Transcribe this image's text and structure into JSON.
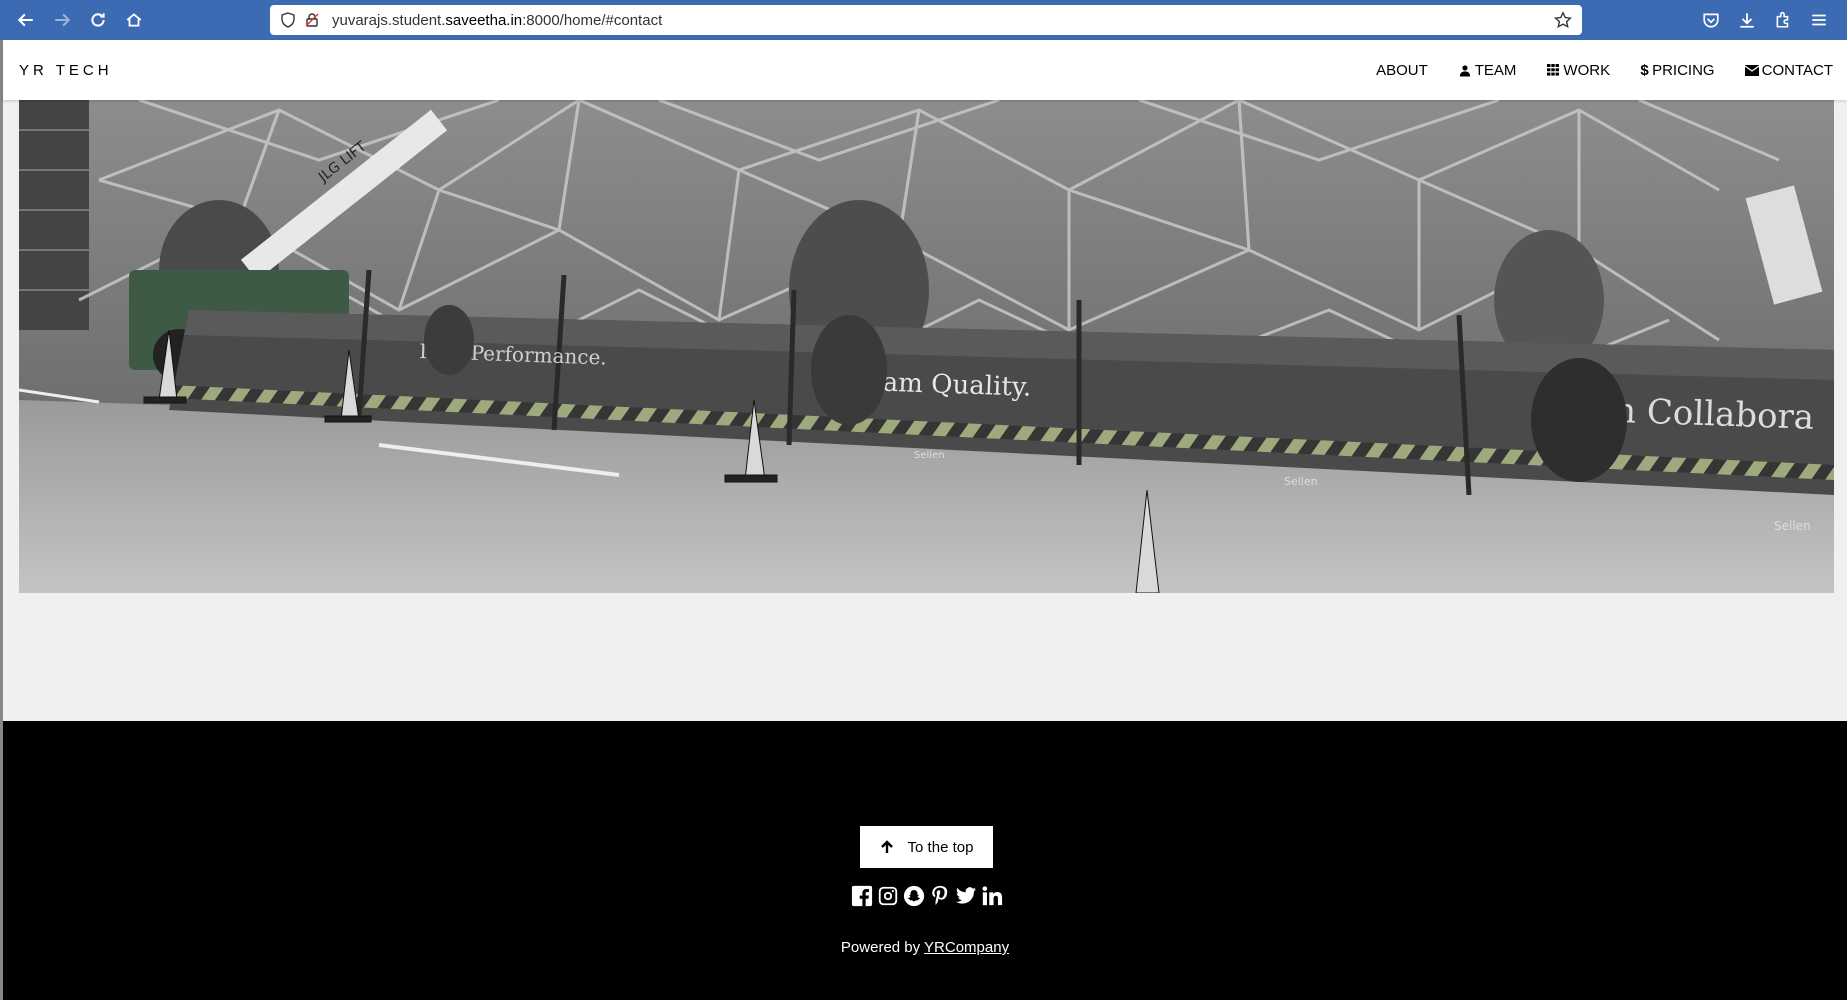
{
  "browser": {
    "url_prefix": "yuvarajs.student.",
    "url_domain": "saveetha.in",
    "url_suffix": ":8000/home/#contact"
  },
  "site": {
    "brand": "YR TECH",
    "nav": [
      {
        "label": "ABOUT",
        "icon": ""
      },
      {
        "label": "TEAM",
        "icon": "user-icon"
      },
      {
        "label": "WORK",
        "icon": "grid-icon"
      },
      {
        "label": "PRICING",
        "icon": "dollar-icon"
      },
      {
        "label": "CONTACT",
        "icon": "envelope-icon"
      }
    ]
  },
  "hero": {
    "signs": [
      "I am Performance.",
      "I am Quality.",
      "I am Collabora"
    ],
    "brand_marks": [
      "Sellen",
      "Sellen",
      "Sellen"
    ],
    "lift_label": "JLG LIFT"
  },
  "footer": {
    "top_button": "To the top",
    "social_icons": [
      "facebook-icon",
      "instagram-icon",
      "snapchat-icon",
      "pinterest-icon",
      "twitter-icon",
      "linkedin-icon"
    ],
    "powered_prefix": "Powered by ",
    "powered_link": "YRCompany"
  },
  "colors": {
    "browser_bar": "#3d6bb3",
    "footer_bg": "#000000",
    "page_bg": "#f0f0f0"
  }
}
